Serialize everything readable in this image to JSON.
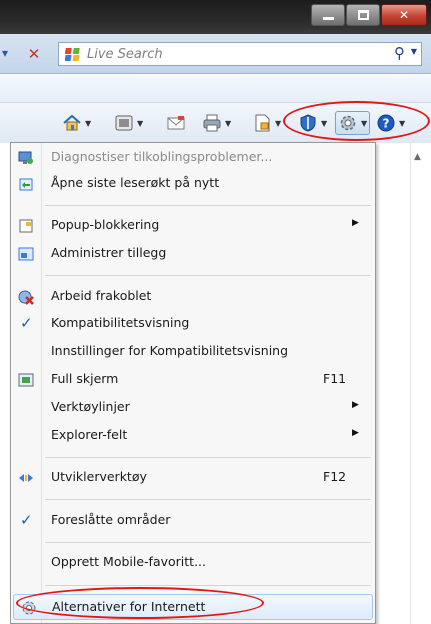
{
  "search": {
    "placeholder": "Live Search",
    "logo_colors": [
      "#e8432a",
      "#5cb82f",
      "#f2b81b",
      "#3a79d8"
    ]
  },
  "window_buttons": [
    "minimize",
    "maximize",
    "close"
  ],
  "toolbar": {
    "tools": [
      "home-icon",
      "feeds-icon",
      "mail-icon",
      "print-icon",
      "page-icon",
      "safety-icon",
      "tools-gear-icon",
      "help-icon"
    ]
  },
  "menu": {
    "items": [
      {
        "label": "Diagnostiser tilkoblingsproblemer...",
        "disabled": true,
        "icon": "diagnose-icon"
      },
      {
        "label": "Åpne siste leserøkt på nytt",
        "icon": "reopen-session-icon"
      },
      {
        "label": "Popup-blokkering",
        "submenu": true,
        "icon": "popup-blocker-icon"
      },
      {
        "label": "Administrer tillegg",
        "icon": "addons-icon"
      },
      {
        "label": "Arbeid frakoblet",
        "icon": "offline-icon"
      },
      {
        "label": "Kompatibilitetsvisning",
        "checked": true
      },
      {
        "label": "Innstillinger for Kompatibilitetsvisning"
      },
      {
        "label": "Full skjerm",
        "shortcut": "F11",
        "icon": "fullscreen-icon"
      },
      {
        "label": "Verktøylinjer",
        "submenu": true
      },
      {
        "label": "Explorer-felt",
        "submenu": true
      },
      {
        "label": "Utviklerverktøy",
        "shortcut": "F12",
        "icon": "developer-tools-icon"
      },
      {
        "label": "Foreslåtte områder",
        "checked": true
      },
      {
        "label": "Opprett Mobile-favoritt..."
      },
      {
        "label": "Alternativer for Internett",
        "hovered": true,
        "icon": "internet-options-icon"
      }
    ]
  },
  "colors": {
    "highlight_red": "#e01818",
    "check_blue": "#1a5fb4",
    "menu_bg": "#f7f7f7"
  }
}
